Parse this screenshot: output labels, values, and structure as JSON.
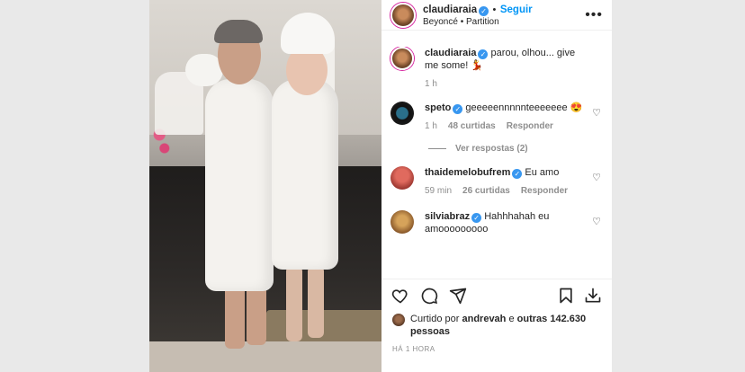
{
  "header": {
    "username": "claudiaraia",
    "follow_label": "Seguir",
    "dot": "•",
    "song": "Beyoncé • Partition",
    "more_icon": "•••"
  },
  "caption": {
    "username": "claudiaraia",
    "text": "parou, olhou... give me some! 💃",
    "time": "1 h"
  },
  "comments": [
    {
      "username": "speto",
      "text": "geeeeennnnnteeeeeee 😍",
      "time": "1 h",
      "likes": "48 curtidas",
      "reply": "Responder",
      "verified": true
    },
    {
      "username": "thaidemelobufrem",
      "text": "Eu amo",
      "time": "59 min",
      "likes": "26 curtidas",
      "reply": "Responder",
      "verified": true
    },
    {
      "username": "silviabraz",
      "text": "Hahhhahah eu amooooooooo",
      "verified": true
    }
  ],
  "view_replies": "Ver respostas (2)",
  "likes": {
    "prefix": "Curtido por",
    "user": "andrevah",
    "middle": "e",
    "rest": "outras 142.630 pessoas"
  },
  "timestamp": "HÁ 1 HORA",
  "icons": {
    "heart": "heart-icon",
    "comment": "comment-icon",
    "share": "share-icon",
    "save": "bookmark-icon",
    "download": "download-icon",
    "verified": "✓"
  },
  "colors": {
    "link": "#0095f6",
    "verified": "#3897f0",
    "muted": "#8e8e8e"
  }
}
